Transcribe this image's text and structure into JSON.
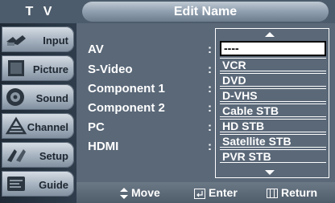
{
  "header": {
    "tv_label": "T V",
    "title": "Edit Name"
  },
  "sidebar": {
    "items": [
      {
        "label": "Input",
        "icon": "input-plug-icon"
      },
      {
        "label": "Picture",
        "icon": "picture-icon"
      },
      {
        "label": "Sound",
        "icon": "speaker-icon"
      },
      {
        "label": "Channel",
        "icon": "antenna-icon"
      },
      {
        "label": "Setup",
        "icon": "setup-icon"
      },
      {
        "label": "Guide",
        "icon": "program-guide-icon"
      }
    ]
  },
  "main": {
    "rows": [
      {
        "label": "AV"
      },
      {
        "label": "S-Video"
      },
      {
        "label": "Component 1"
      },
      {
        "label": "Component 2"
      },
      {
        "label": "PC"
      },
      {
        "label": "HDMI"
      }
    ],
    "colon": ":"
  },
  "dropdown": {
    "options": [
      "----",
      "VCR",
      "DVD",
      "D-VHS",
      "Cable STB",
      "HD STB",
      "Satellite STB",
      "PVR STB"
    ],
    "selected_index": 0
  },
  "footer": {
    "move": "Move",
    "enter": "Enter",
    "return": "Return"
  },
  "colors": {
    "panel": "#5a6878",
    "title_bar": "#4d5c6c",
    "menu_bg": "#2f3d4c"
  }
}
